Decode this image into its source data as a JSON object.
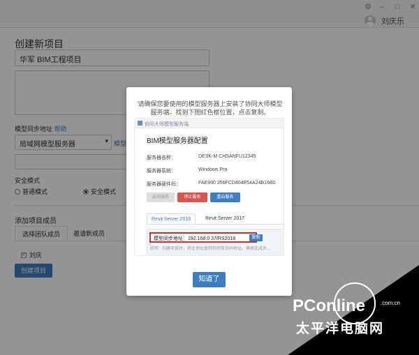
{
  "window": {
    "minimize": "–",
    "maximize": "□",
    "close": "✕",
    "settings_icon": "⚙"
  },
  "user": {
    "name": "刘庆乐"
  },
  "form": {
    "title": "创建新项目",
    "project_name": "华军 BIM工程项目",
    "sync_label": "模型同步地址",
    "help_link": "帮助",
    "server_select": "局域网模型服务器",
    "model_link": "模型",
    "security_label": "安全模式",
    "mode_normal": "普通模式",
    "mode_secure": "安全模式",
    "add_members": "添加项目成员",
    "tab_select_team": "选择团队成员",
    "tab_invite": "邀请新成员",
    "member_name": "刘庆",
    "create_button": "创建项目"
  },
  "modal": {
    "message": "请确保您要使用的模型服务器上安装了协同大师模型服务端。找到下图红色框位置，点击复制。",
    "panel_header": "协同大师模型服务端",
    "panel_title": "BIM模型服务器配置",
    "rows": [
      {
        "label": "服务器名称：",
        "value": "DESK-M   CHSANFU12345"
      },
      {
        "label": "服务器系统：",
        "value": "Windows   Pro"
      },
      {
        "label": "服务器硬件码：",
        "value": "FAE990   356FCD404E54A24B16B0"
      }
    ],
    "btn_start": "启动服务",
    "btn_stop": "停止服务",
    "btn_restart": "重启服务",
    "tab_2018": "Revit Server 2018",
    "tab_2017": "Revit Server 2017",
    "sync_address": "模型同步地址：192.168.0   37/RS2018",
    "copy_button": "复制",
    "note": "说明：创建项目时，将此地址复制到项目协同地址。确保此成员…",
    "ok_button": "知道了"
  },
  "watermark": {
    "brand": "PConline",
    "domain": ".com.cn",
    "chinese": "太平洋电脑网"
  }
}
